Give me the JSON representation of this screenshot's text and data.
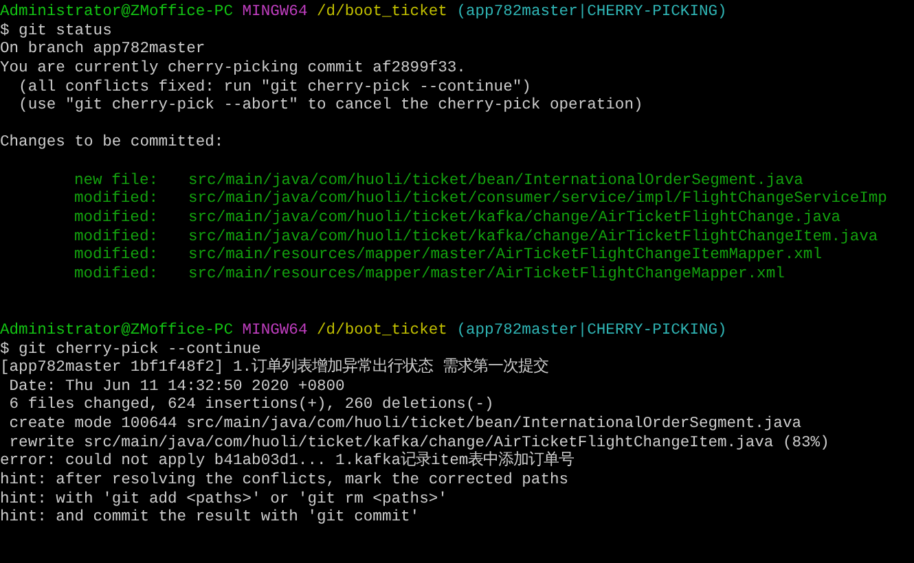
{
  "sessions": [
    {
      "prompt": {
        "user": "Administrator@ZMoffice-PC",
        "system": "MINGW64",
        "path": "/d/boot_ticket",
        "branch": "(app782master|CHERRY-PICKING)"
      },
      "command": "$ git status",
      "output": [
        {
          "kind": "text",
          "text": "On branch app782master"
        },
        {
          "kind": "text",
          "text": "You are currently cherry-picking commit af2899f33."
        },
        {
          "kind": "text",
          "text": "  (all conflicts fixed: run \"git cherry-pick --continue\")"
        },
        {
          "kind": "text",
          "text": "  (use \"git cherry-pick --abort\" to cancel the cherry-pick operation)"
        },
        {
          "kind": "blank"
        },
        {
          "kind": "text",
          "text": "Changes to be committed:"
        },
        {
          "kind": "blank"
        },
        {
          "kind": "staged",
          "status": "new file:",
          "path": "src/main/java/com/huoli/ticket/bean/InternationalOrderSegment.java"
        },
        {
          "kind": "staged",
          "status": "modified:",
          "path": "src/main/java/com/huoli/ticket/consumer/service/impl/FlightChangeServiceImp"
        },
        {
          "kind": "staged",
          "status": "modified:",
          "path": "src/main/java/com/huoli/ticket/kafka/change/AirTicketFlightChange.java"
        },
        {
          "kind": "staged",
          "status": "modified:",
          "path": "src/main/java/com/huoli/ticket/kafka/change/AirTicketFlightChangeItem.java"
        },
        {
          "kind": "staged",
          "status": "modified:",
          "path": "src/main/resources/mapper/master/AirTicketFlightChangeItemMapper.xml"
        },
        {
          "kind": "staged",
          "status": "modified:",
          "path": "src/main/resources/mapper/master/AirTicketFlightChangeMapper.xml"
        },
        {
          "kind": "blank"
        },
        {
          "kind": "blank"
        }
      ]
    },
    {
      "prompt": {
        "user": "Administrator@ZMoffice-PC",
        "system": "MINGW64",
        "path": "/d/boot_ticket",
        "branch": "(app782master|CHERRY-PICKING)"
      },
      "command": "$ git cherry-pick --continue",
      "output": [
        {
          "kind": "text",
          "text": "[app782master 1bf1f48f2] 1.订单列表增加异常出行状态 需求第一次提交"
        },
        {
          "kind": "text",
          "text": " Date: Thu Jun 11 14:32:50 2020 +0800"
        },
        {
          "kind": "text",
          "text": " 6 files changed, 624 insertions(+), 260 deletions(-)"
        },
        {
          "kind": "text",
          "text": " create mode 100644 src/main/java/com/huoli/ticket/bean/InternationalOrderSegment.java"
        },
        {
          "kind": "text",
          "text": " rewrite src/main/java/com/huoli/ticket/kafka/change/AirTicketFlightChangeItem.java (83%)"
        },
        {
          "kind": "text",
          "text": "error: could not apply b41ab03d1... 1.kafka记录item表中添加订单号"
        },
        {
          "kind": "text",
          "text": "hint: after resolving the conflicts, mark the corrected paths"
        },
        {
          "kind": "text",
          "text": "hint: with 'git add <paths>' or 'git rm <paths>'"
        },
        {
          "kind": "text",
          "text": "hint: and commit the result with 'git commit'"
        }
      ]
    }
  ]
}
